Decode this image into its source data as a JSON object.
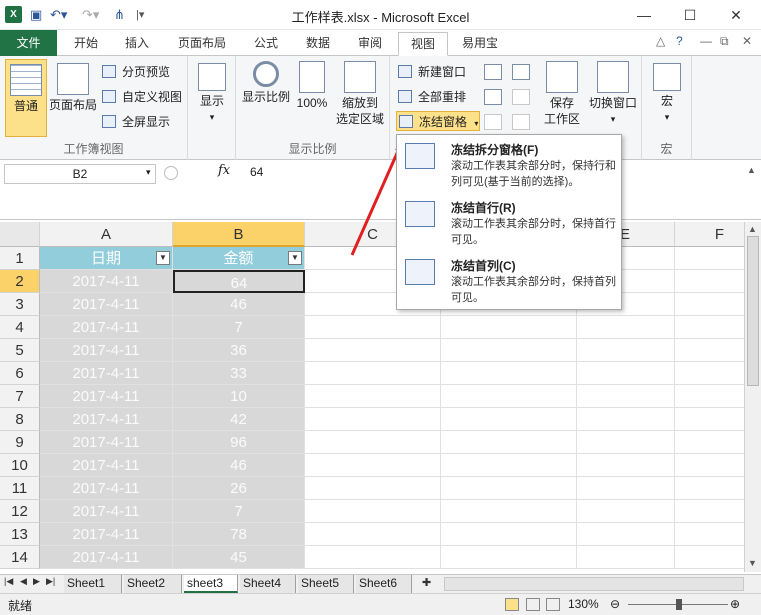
{
  "window": {
    "title": "工作样表.xlsx - Microsoft Excel",
    "minimize": "—",
    "maximize": "☐",
    "close": "✕"
  },
  "quick_access": {
    "save": "💾",
    "undo": "↶",
    "redo": "↷",
    "custom": "⚲"
  },
  "tabs": [
    "文件",
    "开始",
    "插入",
    "页面布局",
    "公式",
    "数据",
    "审阅",
    "视图",
    "易用宝"
  ],
  "active_tab": "视图",
  "ribbon": {
    "workbook_views": {
      "label": "工作簿视图",
      "normal": "普通",
      "page_layout": "页面布局",
      "page_break": "分页预览",
      "custom_views": "自定义视图",
      "full_screen": "全屏显示"
    },
    "show": {
      "label": "显示"
    },
    "zoom": {
      "label": "显示比例",
      "zoom": "显示比例",
      "hundred": "100%",
      "zoom_selection_1": "缩放到",
      "zoom_selection_2": "选定区域"
    },
    "window": {
      "new_window": "新建窗口",
      "arrange_all": "全部重排",
      "freeze_panes": "冻结窗格",
      "save_workspace_1": "保存",
      "save_workspace_2": "工作区",
      "switch_windows": "切换窗口"
    },
    "macros": {
      "label": "宏",
      "macros": "宏"
    }
  },
  "formula_bar": {
    "name_box": "B2",
    "fx": "fx",
    "value": "64"
  },
  "grid": {
    "columns": [
      "A",
      "B",
      "C",
      "D",
      "E",
      "F"
    ],
    "headers": [
      "日期",
      "金额"
    ],
    "rows": [
      {
        "row": "1"
      },
      {
        "row": "2",
        "date": "2017-4-11",
        "amount": "64"
      },
      {
        "row": "3",
        "date": "2017-4-11",
        "amount": "46"
      },
      {
        "row": "4",
        "date": "2017-4-11",
        "amount": "7"
      },
      {
        "row": "5",
        "date": "2017-4-11",
        "amount": "36"
      },
      {
        "row": "6",
        "date": "2017-4-11",
        "amount": "33"
      },
      {
        "row": "7",
        "date": "2017-4-11",
        "amount": "10"
      },
      {
        "row": "8",
        "date": "2017-4-11",
        "amount": "42"
      },
      {
        "row": "9",
        "date": "2017-4-11",
        "amount": "96"
      },
      {
        "row": "10",
        "date": "2017-4-11",
        "amount": "46"
      },
      {
        "row": "11",
        "date": "2017-4-11",
        "amount": "26"
      },
      {
        "row": "12",
        "date": "2017-4-11",
        "amount": "7"
      },
      {
        "row": "13",
        "date": "2017-4-11",
        "amount": "78"
      },
      {
        "row": "14",
        "date": "2017-4-11",
        "amount": "45"
      }
    ]
  },
  "freeze_menu": [
    {
      "title": "冻结拆分窗格(F)",
      "desc": "滚动工作表其余部分时，保持行和列可见(基于当前的选择)。"
    },
    {
      "title": "冻结首行(R)",
      "desc": "滚动工作表其余部分时，保持首行可见。"
    },
    {
      "title": "冻结首列(C)",
      "desc": "滚动工作表其余部分时，保持首列可见。"
    }
  ],
  "sheets": [
    "Sheet1",
    "Sheet2",
    "sheet3",
    "Sheet4",
    "Sheet5",
    "Sheet6"
  ],
  "active_sheet": "sheet3",
  "status": {
    "ready": "就绪",
    "zoom": "130%"
  },
  "colors": {
    "excel_green": "#217346",
    "header_fill": "#92cddc",
    "data_fill": "#d8d8d8",
    "selected_header": "#fbd26a",
    "arrow": "#e02020"
  }
}
